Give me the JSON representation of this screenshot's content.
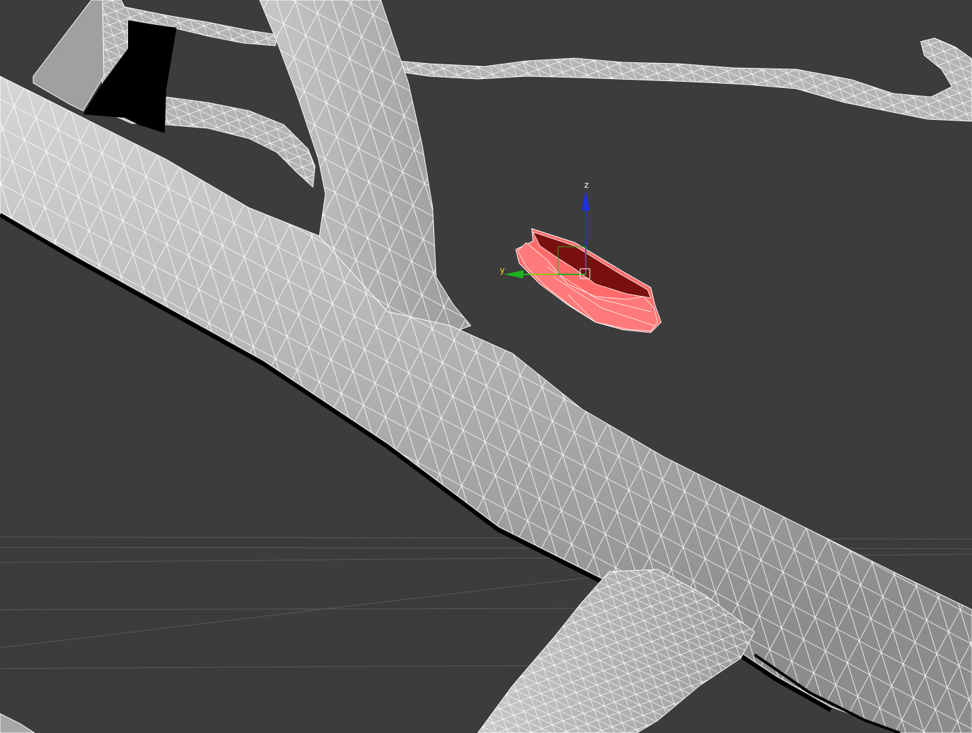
{
  "viewport": {
    "background": "#3c3c3c",
    "wire_color": "#ffffff",
    "mesh_fill": "#a6a6a6",
    "selection_color": "#ff5a5a"
  },
  "gizmo": {
    "z_label": "z",
    "y_label": "y",
    "z_color": "#1f2fe0",
    "y_color": "#1fb01f",
    "x_color": "#ffe000"
  }
}
